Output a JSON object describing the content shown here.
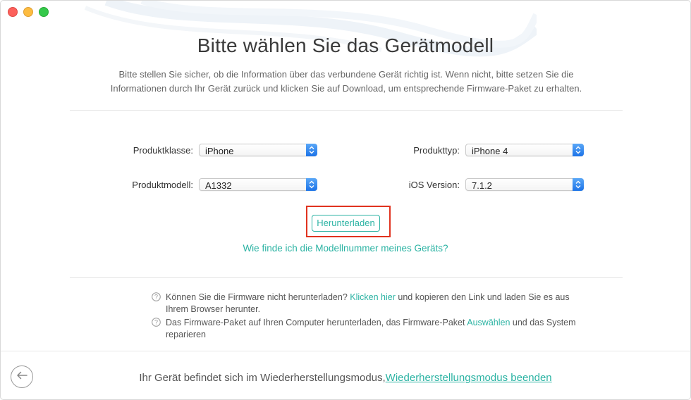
{
  "page": {
    "title": "Bitte wählen Sie das Gerätmodell",
    "subtitle": "Bitte stellen Sie sicher, ob die Information über das verbundene Gerät richtig ist. Wenn nicht, bitte setzen Sie die Informationen durch Ihr Gerät zurück und klicken Sie auf Download, um entsprechende Firmware-Paket zu erhalten."
  },
  "form": {
    "product_class": {
      "label": "Produktklasse:",
      "value": "iPhone"
    },
    "product_type": {
      "label": "Produkttyp:",
      "value": "iPhone 4"
    },
    "product_model": {
      "label": "Produktmodell:",
      "value": "A1332"
    },
    "ios_version": {
      "label": "iOS Version:",
      "value": "7.1.2"
    }
  },
  "download_button": "Herunterladen",
  "help_link": "Wie finde ich die Modellnummer meines Geräts?",
  "notes": [
    {
      "before": "Können Sie die Firmware nicht herunterladen? ",
      "link": "Klicken hier",
      "after": " und kopieren den Link und laden Sie es aus Ihrem Browser herunter."
    },
    {
      "before": "Das Firmware-Paket auf Ihren Computer herunterladen, das Firmware-Paket ",
      "link": "Auswählen",
      "after": " und das System reparieren"
    }
  ],
  "footer": {
    "text": "Ihr Gerät befindet sich im Wiederherstellungsmodus,",
    "link": "Wiederherstellungsmodus beenden"
  },
  "colors": {
    "accent": "#2bb3a3",
    "highlight": "#e0331f",
    "stepper": "#1c73e8"
  },
  "icons": {
    "back": "arrow-left-circle-icon",
    "help": "question-circle-icon",
    "stepper": "up-down-chevron-icon"
  }
}
